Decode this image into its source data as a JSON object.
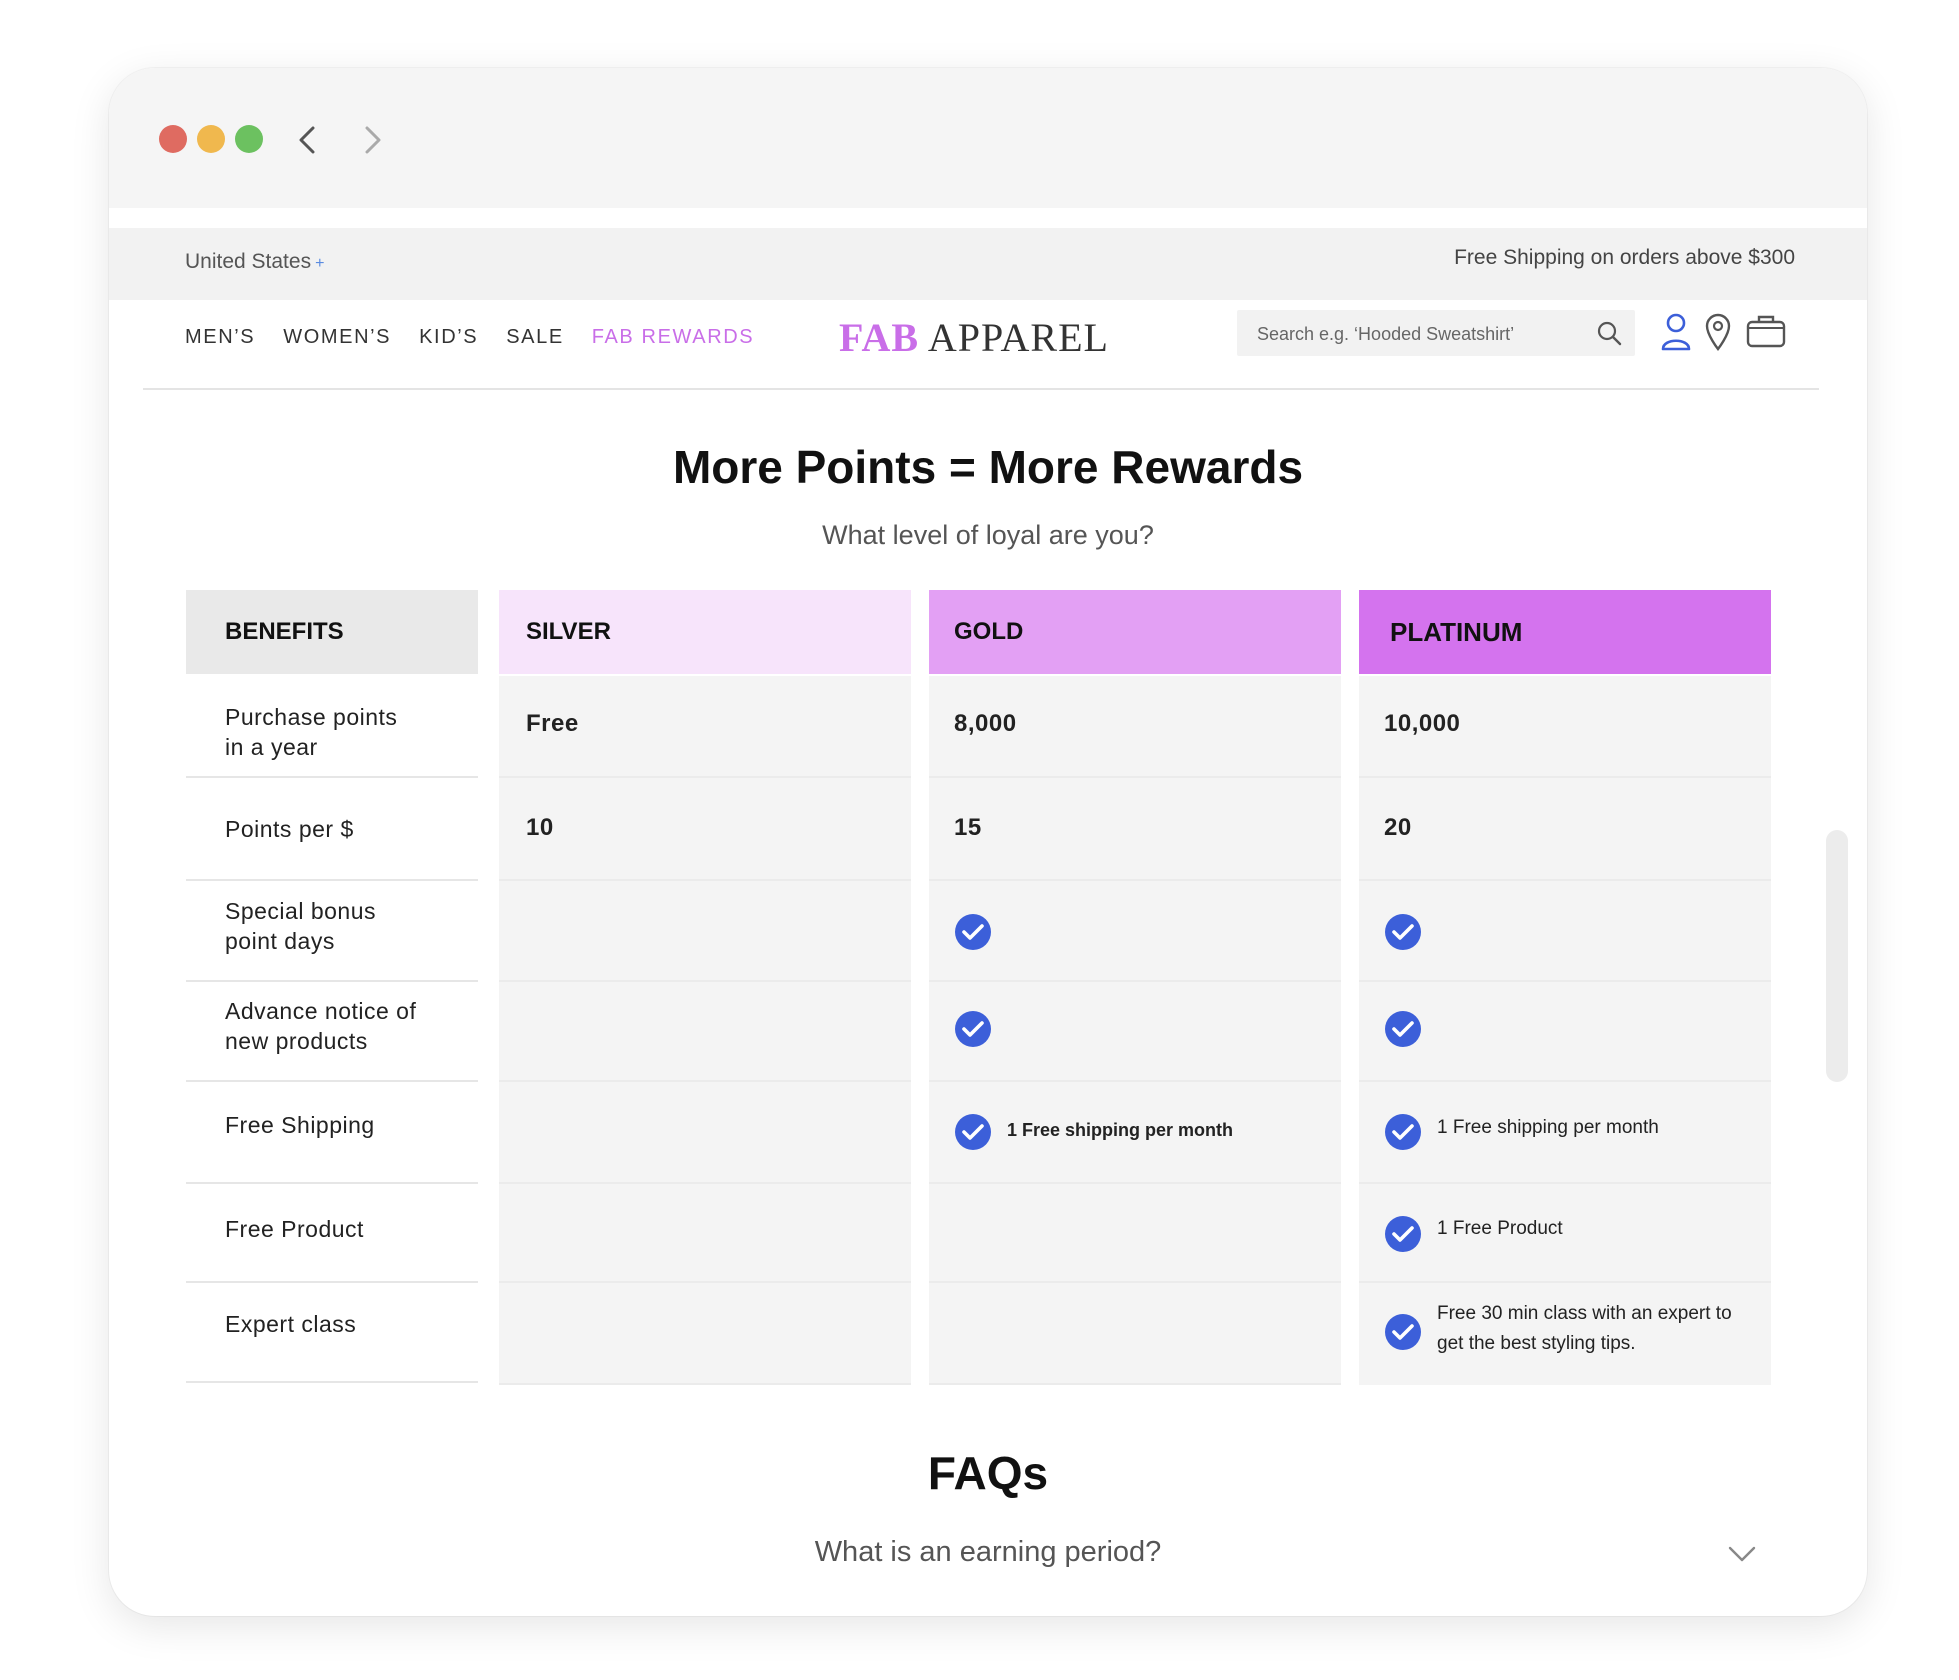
{
  "topbar": {
    "region": "United States",
    "region_plus": "+",
    "shipping_note": "Free Shipping on orders above $300"
  },
  "nav": {
    "links": [
      "MEN’S",
      "WOMEN’S",
      "KID’S",
      "SALE",
      "FAB REWARDS"
    ],
    "active": "FAB REWARDS"
  },
  "logo": {
    "part1": "FAB",
    "part2": "APPAREL"
  },
  "search": {
    "placeholder": "Search e.g. ‘Hooded Sweatshirt’"
  },
  "icons": [
    "back-arrow-icon",
    "forward-arrow-icon",
    "search-icon",
    "user-icon",
    "location-pin-icon",
    "bag-icon",
    "check-circle-icon",
    "chevron-down-icon"
  ],
  "colors": {
    "accent": "#c96ee8",
    "silver": "#f7e4fb",
    "gold": "#e3a0f4",
    "platinum": "#d473ee",
    "check": "#3c5fd9"
  },
  "section": {
    "title": "More Points = More Rewards",
    "subtitle": "What level of loyal are you?"
  },
  "table": {
    "headers": {
      "benefits": "BENEFITS",
      "silver": "SILVER",
      "gold": "GOLD",
      "platinum": "PLATINUM"
    },
    "rows": [
      {
        "benefit": "Purchase points\nin a year",
        "silver": "Free",
        "gold": "8,000",
        "platinum": "10,000"
      },
      {
        "benefit": "Points per $",
        "silver": "10",
        "gold": "15",
        "platinum": "20"
      },
      {
        "benefit": "Special bonus\npoint days",
        "silver": "",
        "gold": "check",
        "platinum": "check"
      },
      {
        "benefit": "Advance notice of\nnew products",
        "silver": "",
        "gold": "check",
        "platinum": "check"
      },
      {
        "benefit": "Free Shipping",
        "silver": "",
        "gold": "1 Free shipping per month",
        "platinum": "1 Free shipping per month"
      },
      {
        "benefit": "Free Product",
        "silver": "",
        "gold": "",
        "platinum": "1 Free Product"
      },
      {
        "benefit": "Expert class",
        "silver": "",
        "gold": "",
        "platinum": "Free 30 min class with an expert to get the best styling tips."
      }
    ]
  },
  "faq": {
    "title": "FAQs",
    "question": "What is an earning period?"
  }
}
